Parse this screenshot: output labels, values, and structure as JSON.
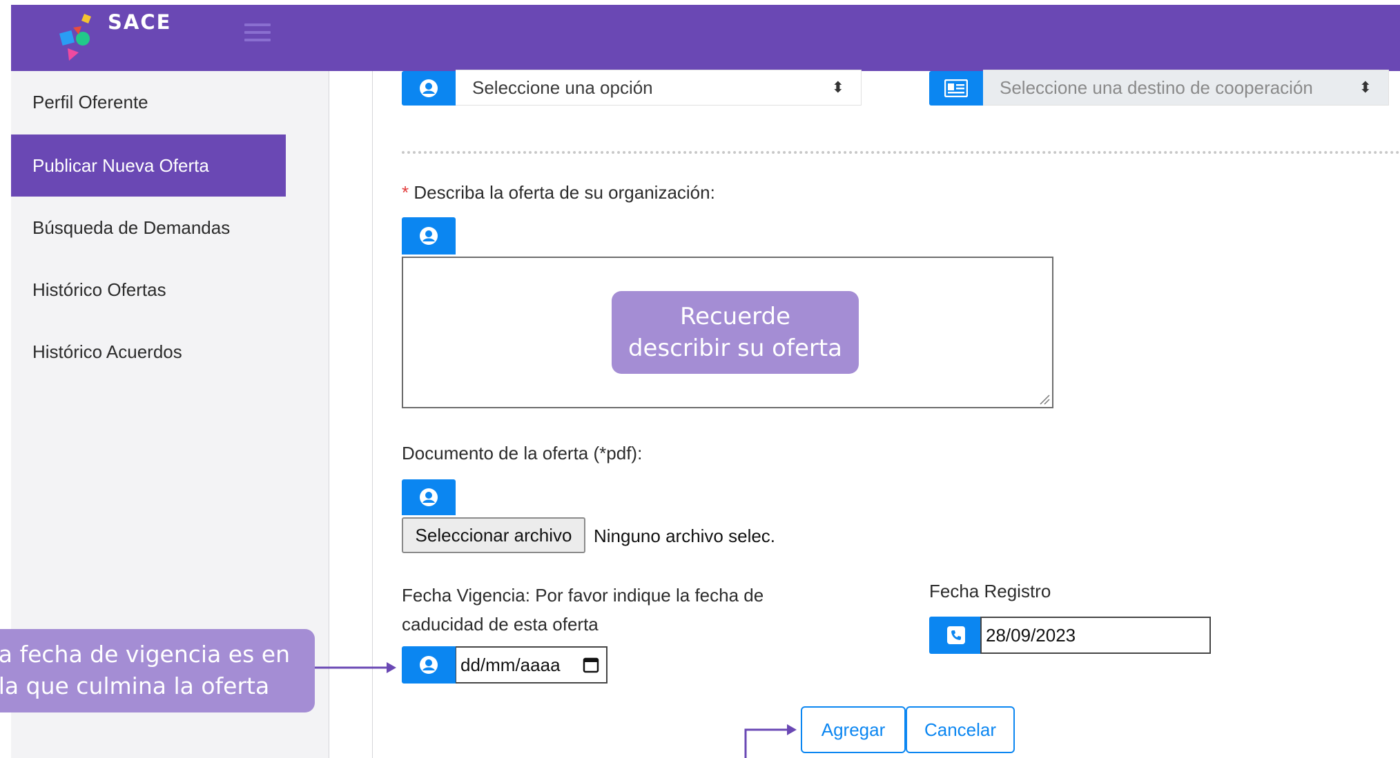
{
  "app": {
    "name": "SACE"
  },
  "sidebar": {
    "items": [
      {
        "label": "Perfil Oferente",
        "active": false
      },
      {
        "label": "Publicar Nueva Oferta",
        "active": true
      },
      {
        "label": "Búsqueda de Demandas",
        "active": false
      },
      {
        "label": "Histórico Ofertas",
        "active": false
      },
      {
        "label": "Histórico Acuerdos",
        "active": false
      }
    ]
  },
  "form": {
    "select_option": {
      "value": "Seleccione una opción",
      "icon": "user-circle-icon"
    },
    "select_destino": {
      "value": "Seleccione una destino de cooperación",
      "icon": "id-card-icon",
      "disabled": true
    },
    "describe": {
      "required_mark": "*",
      "label": "Describa la oferta de su organización:",
      "icon": "user-circle-icon",
      "value": ""
    },
    "document": {
      "label": "Documento de la oferta (*pdf):",
      "icon": "user-circle-icon",
      "button_label": "Seleccionar archivo",
      "status": "Ninguno archivo selec."
    },
    "fecha_vigencia": {
      "label_line1": "Fecha Vigencia: Por favor indique la fecha de",
      "label_line2": "caducidad de esta oferta",
      "icon": "user-circle-icon",
      "placeholder": "dd/mm/aaaa"
    },
    "fecha_registro": {
      "label": "Fecha Registro",
      "icon": "phone-icon",
      "value": "28/09/2023"
    },
    "buttons": {
      "add": "Agregar",
      "cancel": "Cancelar"
    }
  },
  "callouts": {
    "textarea": {
      "line1": "Recuerde",
      "line2": "describir su oferta"
    },
    "date": {
      "line1": "a fecha de vigencia es en",
      "line2": "la que culmina la oferta"
    }
  },
  "colors": {
    "brand": "#6a48b4",
    "accent": "#0b86f1",
    "callout": "#a48dd4",
    "sidebar_bg": "#f3f3f5"
  }
}
